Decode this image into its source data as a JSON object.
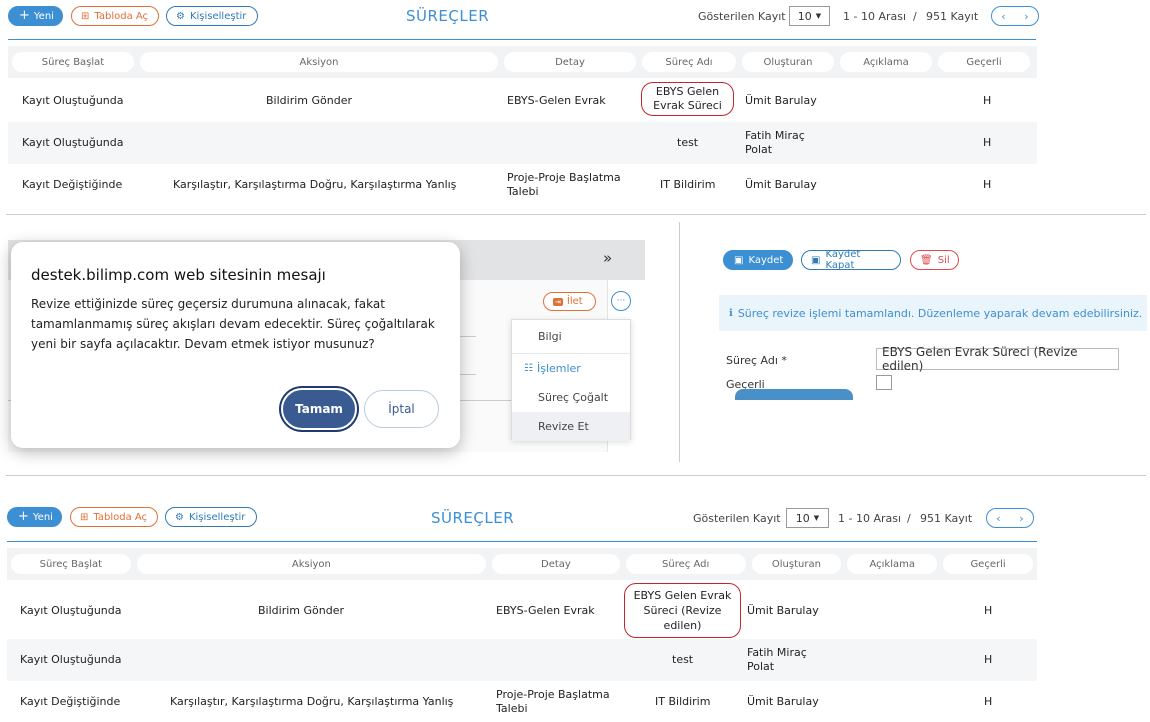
{
  "top": {
    "toolbar": {
      "new_label": "Yeni",
      "table_label": "Tabloda Aç",
      "customize_label": "Kişiselleştir"
    },
    "title": "SÜREÇLER",
    "pager": {
      "shown_label": "Gösterilen Kayıt",
      "page_size": "10",
      "range": "1 - 10 Arası",
      "separator": "/",
      "total": "951 Kayıt"
    },
    "columns": [
      "Süreç Başlat",
      "Aksiyon",
      "Detay",
      "Süreç Adı",
      "Oluşturan",
      "Açıklama",
      "Geçerli"
    ],
    "rows": [
      {
        "start": "Kayıt Oluştuğunda",
        "action": "Bildirim Gönder",
        "detail": "EBYS-Gelen Evrak",
        "name": "EBYS Gelen Evrak Süreci",
        "creator": "Ümit Barulay",
        "desc": "",
        "valid": "H"
      },
      {
        "start": "Kayıt Oluştuğunda",
        "action": "",
        "detail": "",
        "name": "test",
        "creator": "Fatih Miraç Polat",
        "desc": "",
        "valid": "H"
      },
      {
        "start": "Kayıt Değiştiğinde",
        "action": "Karşılaştır, Karşılaştırma Doğru, Karşılaştırma Yanlış",
        "detail": "Proje-Proje Başlatma Talebi",
        "name": "IT Bildirim",
        "creator": "Ümit Barulay",
        "desc": "",
        "valid": "H"
      }
    ]
  },
  "middle": {
    "chevrons": "»",
    "forward_label": "İlet",
    "more_label": "···",
    "menu": {
      "items": [
        "Bilgi",
        "İşlemler",
        "Süreç Çoğalt",
        "Revize Et"
      ]
    },
    "form": {
      "save_label": "Kaydet",
      "save_close_label": "Kaydet Kapat",
      "delete_label": "Sil",
      "info_message": "Süreç revize işlemi tamamlandı. Düzenleme yaparak devam edebilirsiniz.",
      "name_label": "Süreç Adı *",
      "name_value": "EBYS Gelen Evrak Süreci (Revize edilen)",
      "valid_label": "Geçerli"
    },
    "dialog": {
      "title": "destek.bilimp.com web sitesinin mesajı",
      "message": "Revize ettiğinizde süreç geçersiz durumuna alınacak, fakat tamamlanmamış süreç akışları devam edecektir. Süreç çoğaltılarak yeni bir sayfa açılacaktır. Devam etmek istiyor musunuz?",
      "ok_label": "Tamam",
      "cancel_label": "İptal"
    }
  },
  "bottom": {
    "toolbar": {
      "new_label": "Yeni",
      "table_label": "Tabloda Aç",
      "customize_label": "Kişiselleştir"
    },
    "title": "SÜREÇLER",
    "pager": {
      "shown_label": "Gösterilen Kayıt",
      "page_size": "10",
      "range": "1 - 10 Arası",
      "separator": "/",
      "total": "951 Kayıt"
    },
    "columns": [
      "Süreç Başlat",
      "Aksiyon",
      "Detay",
      "Süreç Adı",
      "Oluşturan",
      "Açıklama",
      "Geçerli"
    ],
    "rows": [
      {
        "start": "Kayıt Oluştuğunda",
        "action": "Bildirim Gönder",
        "detail": "EBYS-Gelen Evrak",
        "name": "EBYS Gelen Evrak Süreci (Revize edilen)",
        "creator": "Ümit Barulay",
        "desc": "",
        "valid": "H"
      },
      {
        "start": "Kayıt Oluştuğunda",
        "action": "",
        "detail": "",
        "name": "test",
        "creator": "Fatih Miraç Polat",
        "desc": "",
        "valid": "H"
      },
      {
        "start": "Kayıt Değiştiğinde",
        "action": "Karşılaştır, Karşılaştırma Doğru, Karşılaştırma Yanlış",
        "detail": "Proje-Proje Başlatma Talebi",
        "name": "IT Bildirim",
        "creator": "Ümit Barulay",
        "desc": "",
        "valid": "H"
      }
    ]
  }
}
